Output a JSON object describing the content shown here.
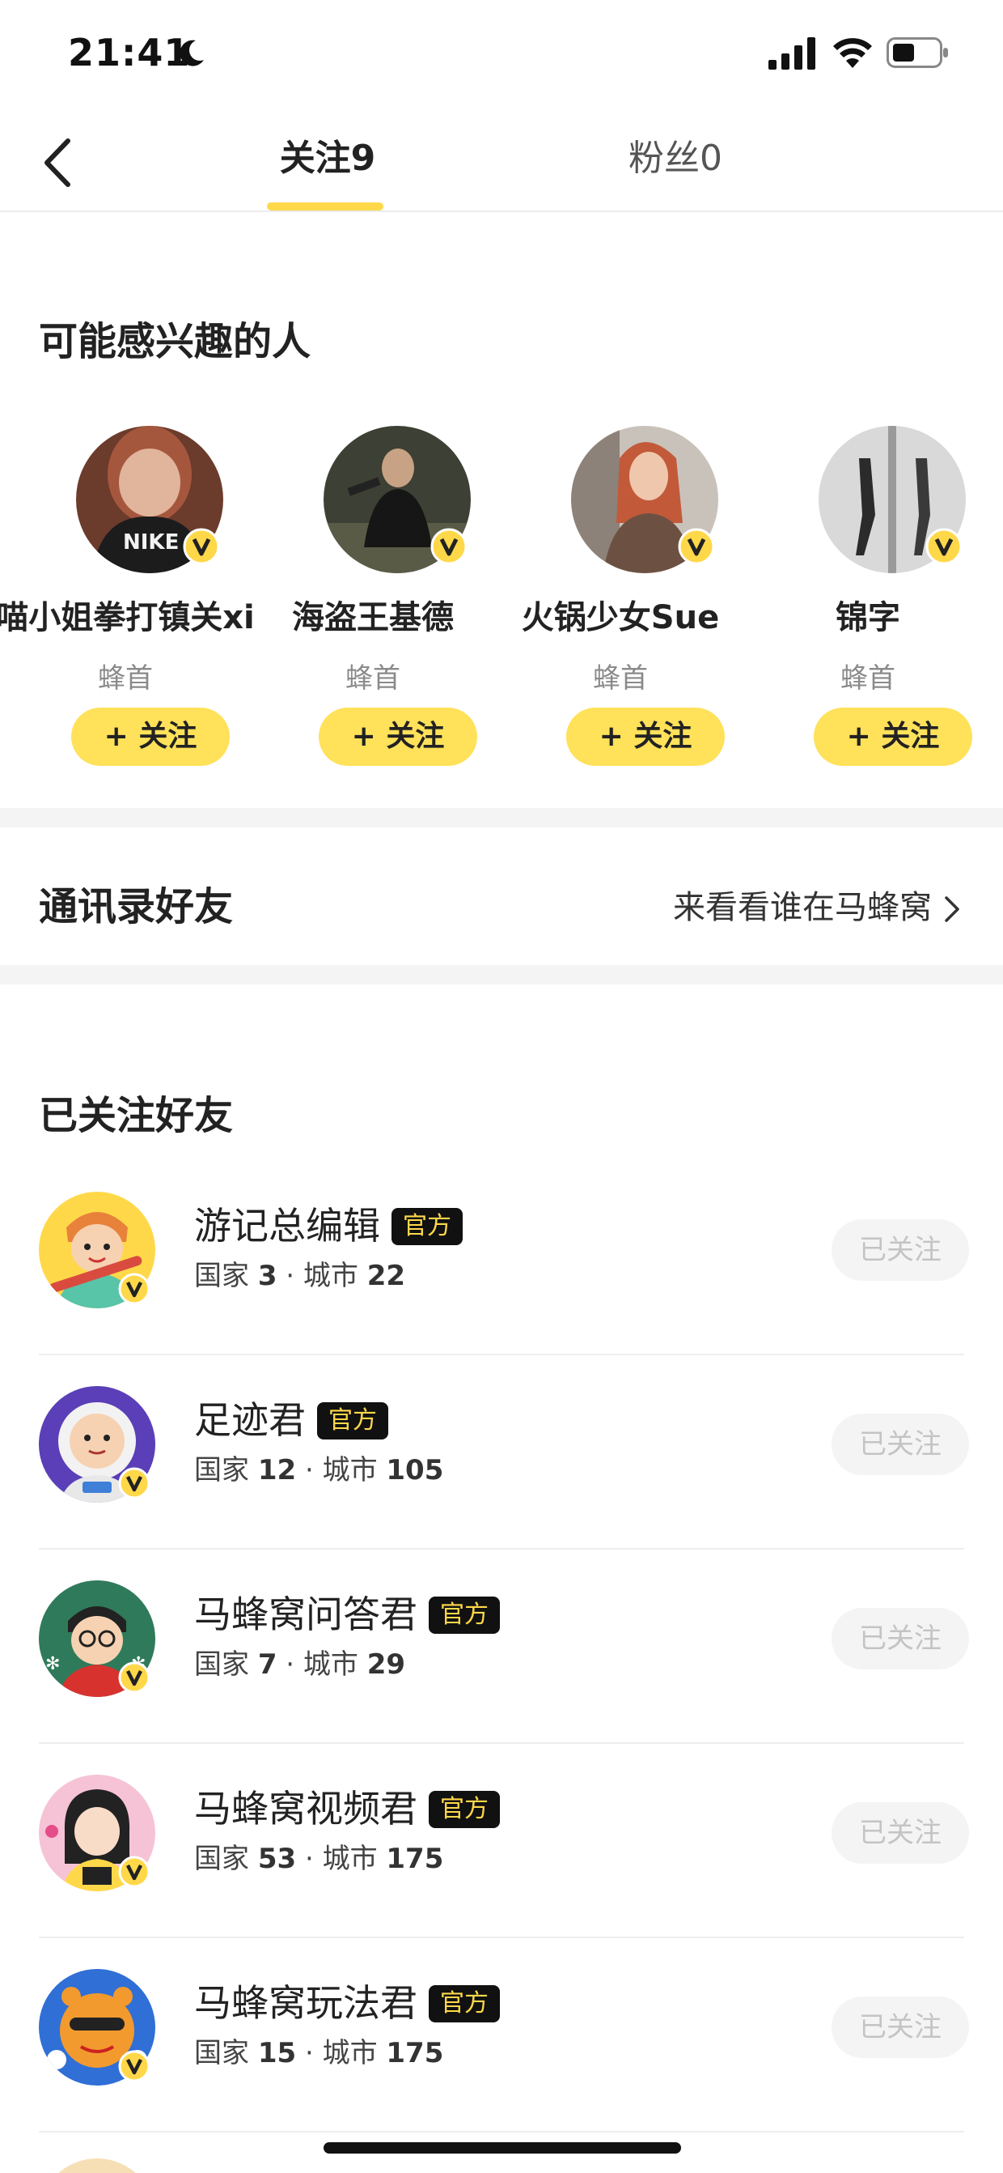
{
  "status_bar": {
    "time": "21:41"
  },
  "nav": {
    "tabs": [
      {
        "label": "关注9",
        "active": true
      },
      {
        "label": "粉丝0",
        "active": false
      }
    ]
  },
  "suggestions": {
    "title": "可能感兴趣的人",
    "follow_label": "+ 关注",
    "people": [
      {
        "name": "喵小姐拳打镇关xi",
        "role": "蜂首"
      },
      {
        "name": "海盗王基德",
        "role": "蜂首"
      },
      {
        "name": "火锅少女Sue",
        "role": "蜂首"
      },
      {
        "name": "锦字",
        "role": "蜂首"
      }
    ]
  },
  "contacts": {
    "title": "通讯录好友",
    "link": "来看看谁在马蜂窝"
  },
  "followed": {
    "title": "已关注好友",
    "official_label": "官方",
    "followed_label": "已关注",
    "country_label": "国家",
    "city_label": "城市",
    "separator": "·",
    "friends": [
      {
        "name": "游记总编辑",
        "countries": "3",
        "cities": "22"
      },
      {
        "name": "足迹君",
        "countries": "12",
        "cities": "105"
      },
      {
        "name": "马蜂窝问答君",
        "countries": "7",
        "cities": "29"
      },
      {
        "name": "马蜂窝视频君",
        "countries": "53",
        "cities": "175"
      },
      {
        "name": "马蜂窝玩法君",
        "countries": "15",
        "cities": "175"
      }
    ]
  },
  "colors": {
    "accent_yellow": "#ffe15a",
    "official_badge_bg": "#111111",
    "official_badge_text": "#ffd84a"
  }
}
